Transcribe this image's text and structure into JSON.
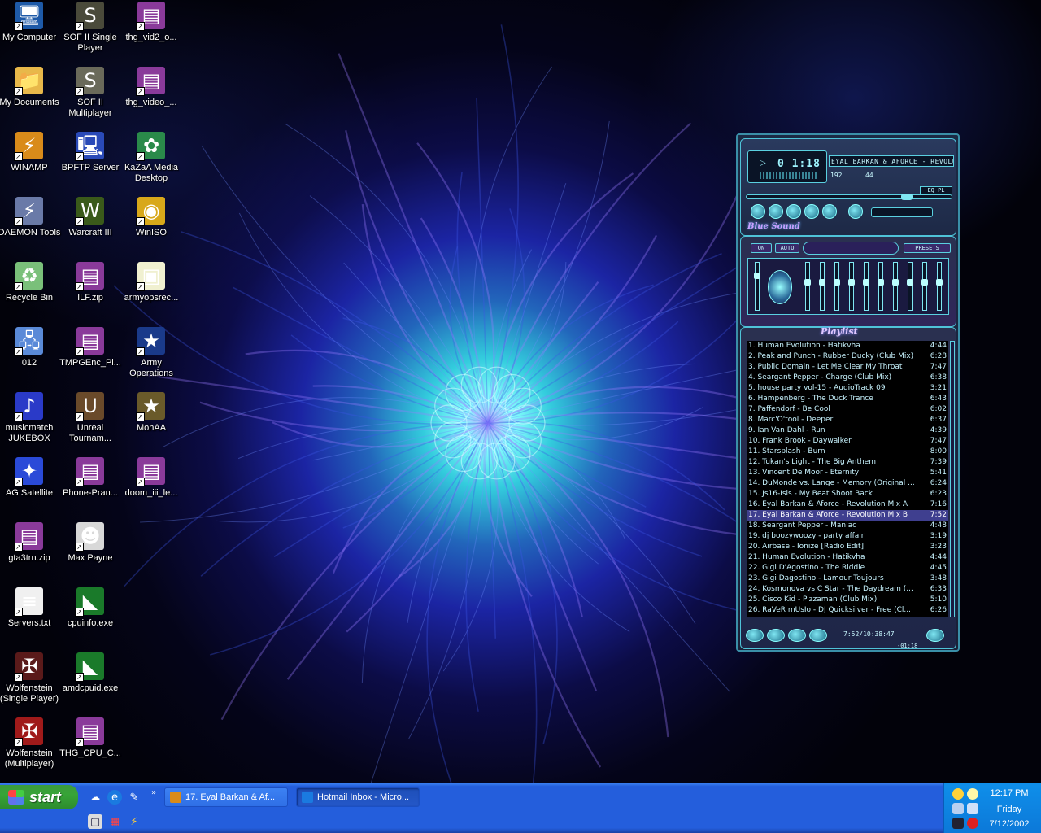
{
  "desktop": {
    "icons": [
      {
        "label": "My Computer",
        "icon": "my-computer-icon",
        "glyph": "🖥",
        "bg": "#1e5aa8"
      },
      {
        "label": "My Documents",
        "icon": "folder-icon",
        "glyph": "📁",
        "bg": "#e8b84a"
      },
      {
        "label": "WINAMP",
        "icon": "winamp-icon",
        "glyph": "⚡",
        "bg": "#d98b1a"
      },
      {
        "label": "DAEMON Tools",
        "icon": "daemon-tools-icon",
        "glyph": "⚡",
        "bg": "#6a7aa8"
      },
      {
        "label": "Recycle Bin",
        "icon": "recycle-bin-icon",
        "glyph": "♻",
        "bg": "#7ac07a"
      },
      {
        "label": "012",
        "icon": "network-computer-icon",
        "glyph": "🖧",
        "bg": "#5a8ad8"
      },
      {
        "label": "musicmatch JUKEBOX",
        "icon": "musicmatch-icon",
        "glyph": "♪",
        "bg": "#2a3ac8"
      },
      {
        "label": "AG Satellite",
        "icon": "satellite-icon",
        "glyph": "✦",
        "bg": "#2a4ad8"
      },
      {
        "label": "gta3trn.zip",
        "icon": "winrar-archive-icon",
        "glyph": "▤",
        "bg": "#8a3a9a"
      },
      {
        "label": "Servers.txt",
        "icon": "text-file-icon",
        "glyph": "≡",
        "bg": "#f0f0f0"
      },
      {
        "label": "Wolfenstein (Single Player)",
        "icon": "wolfenstein-icon",
        "glyph": "✠",
        "bg": "#5a1a1a"
      },
      {
        "label": "Wolfenstein (Multiplayer)",
        "icon": "wolfenstein-mp-icon",
        "glyph": "✠",
        "bg": "#a01a1a"
      },
      {
        "label": "SOF II Single Player",
        "icon": "sof2-icon",
        "glyph": "S",
        "bg": "#4a4a3a"
      },
      {
        "label": "SOF II Multiplayer",
        "icon": "sof2-mp-icon",
        "glyph": "S",
        "bg": "#6a6a5a"
      },
      {
        "label": "BPFTP Server",
        "icon": "ftp-server-icon",
        "glyph": "🖳",
        "bg": "#2a4ab8"
      },
      {
        "label": "Warcraft III",
        "icon": "warcraft-icon",
        "glyph": "W",
        "bg": "#3a5a1a"
      },
      {
        "label": "ILF.zip",
        "icon": "winrar-archive-icon",
        "glyph": "▤",
        "bg": "#8a3a9a"
      },
      {
        "label": "TMPGEnc_Pl...",
        "icon": "winrar-archive-icon",
        "glyph": "▤",
        "bg": "#8a3a9a"
      },
      {
        "label": "Unreal Tournam...",
        "icon": "unreal-icon",
        "glyph": "U",
        "bg": "#6a4a2a"
      },
      {
        "label": "Phone-Pran...",
        "icon": "winrar-archive-icon",
        "glyph": "▤",
        "bg": "#8a3a9a"
      },
      {
        "label": "Max Payne",
        "icon": "max-payne-icon",
        "glyph": "☻",
        "bg": "#d8d8d8"
      },
      {
        "label": "cpuinfo.exe",
        "icon": "amd-icon",
        "glyph": "◣",
        "bg": "#1a7a2a"
      },
      {
        "label": "amdcpuid.exe",
        "icon": "amd-icon",
        "glyph": "◣",
        "bg": "#1a7a2a"
      },
      {
        "label": "THG_CPU_C...",
        "icon": "winrar-archive-icon",
        "glyph": "▤",
        "bg": "#8a3a9a"
      },
      {
        "label": "thg_vid2_o...",
        "icon": "winrar-archive-icon",
        "glyph": "▤",
        "bg": "#8a3a9a"
      },
      {
        "label": "thg_video_...",
        "icon": "winrar-archive-icon",
        "glyph": "▤",
        "bg": "#8a3a9a"
      },
      {
        "label": "KaZaA Media Desktop",
        "icon": "kazaa-icon",
        "glyph": "✿",
        "bg": "#2a8a4a"
      },
      {
        "label": "WinISO",
        "icon": "winiso-icon",
        "glyph": "◉",
        "bg": "#d8a81a"
      },
      {
        "label": "armyopsrec...",
        "icon": "document-icon",
        "glyph": "▣",
        "bg": "#f0f0d0"
      },
      {
        "label": "Army Operations",
        "icon": "army-operations-icon",
        "glyph": "★",
        "bg": "#1a3a8a"
      },
      {
        "label": "MohAA",
        "icon": "mohaa-icon",
        "glyph": "★",
        "bg": "#6a5a2a"
      },
      {
        "label": "doom_iii_le...",
        "icon": "winrar-archive-icon",
        "glyph": "▤",
        "bg": "#8a3a9a"
      }
    ]
  },
  "winamp": {
    "time": "0 1:18",
    "ticker": "EYAL BARKAN & AFORCE - REVOLUTI",
    "kbps": "192",
    "khz": "44",
    "eq_pl": "EQ  PL",
    "skin_name": "Blue Sound",
    "eq_on": "ON",
    "eq_auto": "AUTO",
    "eq_presets": "PRESETS",
    "playlist_title": "Playlist",
    "playlist_time": "7:52/10:38:47",
    "playlist_remaining": "-01:18",
    "selected_index": 16,
    "tracks": [
      {
        "title": "1. Human Evolution  -  Hatikvha",
        "dur": "4:44"
      },
      {
        "title": "2. Peak and Punch - Rubber Ducky (Club Mix)",
        "dur": "6:28"
      },
      {
        "title": "3. Public Domain - Let Me Clear My Throat",
        "dur": "7:47"
      },
      {
        "title": "4. Seargant Pepper - Charge (Club Mix)",
        "dur": "6:38"
      },
      {
        "title": "5. house party vol-15 - AudioTrack 09",
        "dur": "3:21"
      },
      {
        "title": "6. Hampenberg - The Duck Trance",
        "dur": "6:43"
      },
      {
        "title": "7. Paffendorf - Be Cool",
        "dur": "6:02"
      },
      {
        "title": "8. Marc'O'tool - Deeper",
        "dur": "6:37"
      },
      {
        "title": "9. Ian Van Dahl - Run",
        "dur": "4:39"
      },
      {
        "title": "10. Frank Brook - Daywalker",
        "dur": "7:47"
      },
      {
        "title": "11. Starsplash - Burn",
        "dur": "8:00"
      },
      {
        "title": "12. Tukan's Light - The Big Anthem",
        "dur": "7:39"
      },
      {
        "title": "13. Vincent De Moor - Eternity",
        "dur": "5:41"
      },
      {
        "title": "14. DuMonde vs. Lange - Memory (Original ...",
        "dur": "6:24"
      },
      {
        "title": "15. Js16-Isis - My Beat Shoot Back",
        "dur": "6:23"
      },
      {
        "title": "16. Eyal Barkan & Aforce - Revolution Mix A",
        "dur": "7:16"
      },
      {
        "title": "17. Eyal Barkan & Aforce - Revolution Mix B",
        "dur": "7:52"
      },
      {
        "title": "18. Seargant Pepper - Maniac",
        "dur": "4:48"
      },
      {
        "title": "19. dj boozywoozy - party affair",
        "dur": "3:19"
      },
      {
        "title": "20. Airbase - Ionize [Radio Edit]",
        "dur": "3:23"
      },
      {
        "title": "21. Human Evolution  -  Hatikvha",
        "dur": "4:44"
      },
      {
        "title": "22. Gigi D'Agostino  -  The Riddle",
        "dur": "4:45"
      },
      {
        "title": "23. Gigi Dagostino  -  Lamour Toujours",
        "dur": "3:48"
      },
      {
        "title": "24. Kosmonova vs C Star - The Daydream (...",
        "dur": "6:33"
      },
      {
        "title": "25. Cisco Kid - Pizzaman (Club Mix)",
        "dur": "5:10"
      },
      {
        "title": "26. RaVeR mUsIo - DJ Quicksilver - Free (Cl...",
        "dur": "6:26"
      }
    ]
  },
  "taskbar": {
    "start_label": "start",
    "tasks": [
      {
        "label": "17. Eyal Barkan & Af...",
        "icon": "winamp-icon",
        "color": "#d98b1a"
      },
      {
        "label": "Hotmail Inbox - Micro...",
        "icon": "internet-explorer-icon",
        "color": "#1a7ae0"
      }
    ],
    "clock": {
      "time": "12:17 PM",
      "day": "Friday",
      "date": "7/12/2002"
    }
  },
  "colors": {
    "taskbar": "#245edc",
    "start": "#37a437",
    "tray": "#0f8fea",
    "selection": "#3f3f8f"
  }
}
